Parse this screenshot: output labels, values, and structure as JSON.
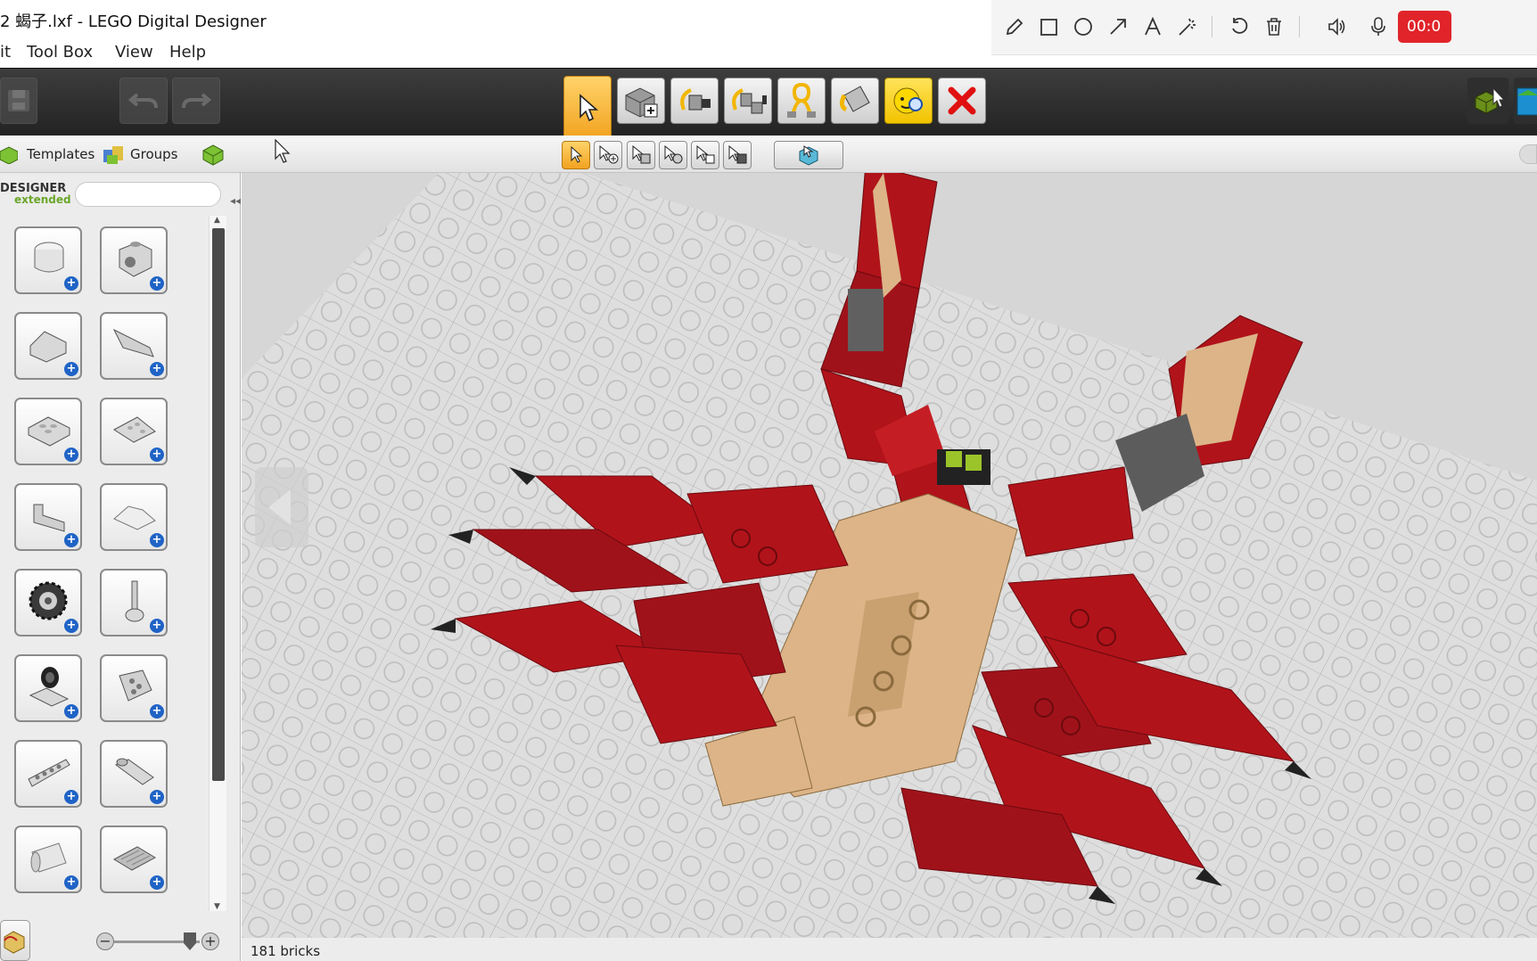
{
  "window": {
    "title": "2 蝎子.lxf - LEGO Digital Designer"
  },
  "recorder": {
    "tools": [
      "pencil-icon",
      "rectangle-icon",
      "circle-icon",
      "arrow-icon",
      "text-icon",
      "magic-wand-icon",
      "undo-icon",
      "trash-icon",
      "speaker-icon",
      "microphone-icon",
      "close-icon"
    ],
    "timer": "00:0",
    "timer_color": "#e0242a"
  },
  "menu": {
    "items": [
      "it",
      "Tool Box",
      "View",
      "Help"
    ]
  },
  "toolbar": {
    "tools": [
      "select-tool",
      "clone-tool",
      "hinge-tool",
      "hinge-align-tool",
      "flex-tool",
      "paint-tool",
      "hide-tool",
      "delete-tool"
    ],
    "active_color": "#f2a21f"
  },
  "tabs": {
    "templates": "Templates",
    "groups": "Groups"
  },
  "brand": {
    "line1": "DESIGNER",
    "line2": "extended"
  },
  "search": {
    "placeholder": ""
  },
  "palette": {
    "bricks": [
      "round-brick",
      "technic-brick",
      "slope-brick",
      "wedge-brick",
      "plate-brick",
      "wedge-plate-brick",
      "tile-brick",
      "windscreen-brick",
      "gear-brick",
      "lever-brick",
      "minifig-head-brick",
      "technic-connector-brick",
      "technic-beam-brick",
      "axle-pin-brick",
      "cylinder-brick",
      "grille-plate-brick"
    ]
  },
  "status": {
    "brick_count": "181 bricks"
  },
  "viewport": {
    "background_color": "#d9d9d9",
    "model_primary_color": "#b1131a",
    "model_secondary_color": "#dcb488"
  }
}
